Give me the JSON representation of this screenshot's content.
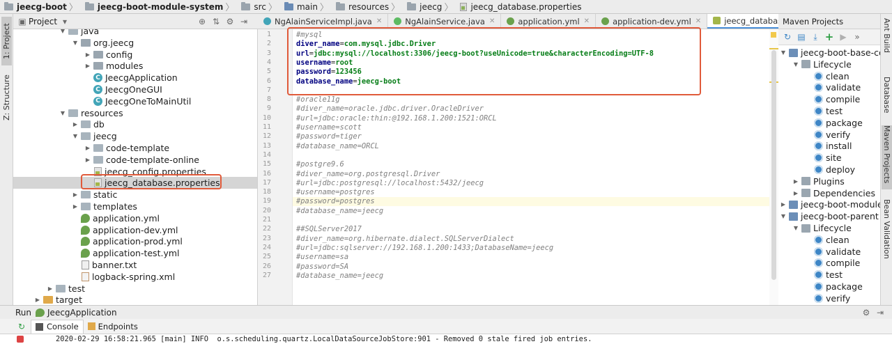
{
  "breadcrumbs": [
    "jeecg-boot",
    "jeecg-boot-module-system",
    "src",
    "main",
    "resources",
    "jeecg",
    "jeecg_database.properties"
  ],
  "left_strip": {
    "project": "1: Project",
    "structure": "Z: Structure"
  },
  "project_panel": {
    "title": "Project"
  },
  "tree": [
    {
      "label": "java",
      "depth": 4,
      "arrow": "open",
      "icon": "folder-blue"
    },
    {
      "label": "org.jeecg",
      "depth": 5,
      "arrow": "open",
      "icon": "package"
    },
    {
      "label": "config",
      "depth": 6,
      "arrow": "closed",
      "icon": "package"
    },
    {
      "label": "modules",
      "depth": 6,
      "arrow": "closed",
      "icon": "package"
    },
    {
      "label": "JeecgApplication",
      "depth": 6,
      "arrow": "none",
      "icon": "class"
    },
    {
      "label": "JeecgOneGUI",
      "depth": 6,
      "arrow": "none",
      "icon": "class"
    },
    {
      "label": "JeecgOneToMainUtil",
      "depth": 6,
      "arrow": "none",
      "icon": "class"
    },
    {
      "label": "resources",
      "depth": 4,
      "arrow": "open",
      "icon": "folder-res"
    },
    {
      "label": "db",
      "depth": 5,
      "arrow": "closed",
      "icon": "folder"
    },
    {
      "label": "jeecg",
      "depth": 5,
      "arrow": "open",
      "icon": "folder"
    },
    {
      "label": "code-template",
      "depth": 6,
      "arrow": "closed",
      "icon": "folder"
    },
    {
      "label": "code-template-online",
      "depth": 6,
      "arrow": "closed",
      "icon": "folder"
    },
    {
      "label": "jeecg_config.properties",
      "depth": 6,
      "arrow": "none",
      "icon": "properties"
    },
    {
      "label": "jeecg_database.properties",
      "depth": 6,
      "arrow": "none",
      "icon": "properties",
      "selected": true
    },
    {
      "label": "static",
      "depth": 5,
      "arrow": "closed",
      "icon": "folder"
    },
    {
      "label": "templates",
      "depth": 5,
      "arrow": "closed",
      "icon": "folder"
    },
    {
      "label": "application.yml",
      "depth": 5,
      "arrow": "none",
      "icon": "yml"
    },
    {
      "label": "application-dev.yml",
      "depth": 5,
      "arrow": "none",
      "icon": "yml"
    },
    {
      "label": "application-prod.yml",
      "depth": 5,
      "arrow": "none",
      "icon": "yml"
    },
    {
      "label": "application-test.yml",
      "depth": 5,
      "arrow": "none",
      "icon": "yml"
    },
    {
      "label": "banner.txt",
      "depth": 5,
      "arrow": "none",
      "icon": "txt"
    },
    {
      "label": "logback-spring.xml",
      "depth": 5,
      "arrow": "none",
      "icon": "xml"
    },
    {
      "label": "test",
      "depth": 3,
      "arrow": "closed",
      "icon": "folder"
    },
    {
      "label": "target",
      "depth": 2,
      "arrow": "closed",
      "icon": "folder-orange"
    }
  ],
  "editor_tabs": [
    {
      "label": "NgAlainServiceImpl.java",
      "icon": "class"
    },
    {
      "label": "NgAlainService.java",
      "icon": "interface"
    },
    {
      "label": "application.yml",
      "icon": "yml"
    },
    {
      "label": "application-dev.yml",
      "icon": "yml"
    },
    {
      "label": "jeecg_database.properties",
      "icon": "properties",
      "active": true
    }
  ],
  "tab_overflow": "≡5",
  "code_lines": [
    {
      "n": "1",
      "parts": [
        [
          "cmt",
          "#mysql"
        ]
      ]
    },
    {
      "n": "2",
      "parts": [
        [
          "key",
          "diver_name"
        ],
        [
          "eq",
          "="
        ],
        [
          "val",
          "com.mysql.jdbc.Driver"
        ]
      ]
    },
    {
      "n": "3",
      "parts": [
        [
          "key",
          "url"
        ],
        [
          "eq",
          "="
        ],
        [
          "val",
          "jdbc:mysql://localhost:3306/jeecg-boot?useUnicode=true&characterEncoding=UTF-8"
        ]
      ]
    },
    {
      "n": "4",
      "parts": [
        [
          "key",
          "username"
        ],
        [
          "eq",
          "="
        ],
        [
          "val",
          "root"
        ]
      ]
    },
    {
      "n": "5",
      "parts": [
        [
          "key",
          "password"
        ],
        [
          "eq",
          "="
        ],
        [
          "val",
          "123456"
        ]
      ]
    },
    {
      "n": "6",
      "parts": [
        [
          "key",
          "database_name"
        ],
        [
          "eq",
          "="
        ],
        [
          "val",
          "jeecg-boot"
        ]
      ]
    },
    {
      "n": "7",
      "parts": []
    },
    {
      "n": "8",
      "parts": [
        [
          "cmt",
          "#oracle11g"
        ]
      ]
    },
    {
      "n": "9",
      "parts": [
        [
          "cmt",
          "#diver_name=oracle.jdbc.driver.OracleDriver"
        ]
      ]
    },
    {
      "n": "10",
      "parts": [
        [
          "cmt",
          "#url=jdbc:oracle:thin:@192.168.1.200:1521:ORCL"
        ]
      ]
    },
    {
      "n": "11",
      "parts": [
        [
          "cmt",
          "#username=scott"
        ]
      ]
    },
    {
      "n": "12",
      "parts": [
        [
          "cmt",
          "#password=tiger"
        ]
      ]
    },
    {
      "n": "13",
      "parts": [
        [
          "cmt",
          "#database_name=ORCL"
        ]
      ]
    },
    {
      "n": "14",
      "parts": []
    },
    {
      "n": "15",
      "parts": [
        [
          "cmt",
          "#postgre9.6"
        ]
      ]
    },
    {
      "n": "16",
      "parts": [
        [
          "cmt",
          "#diver_name=org.postgresql.Driver"
        ]
      ]
    },
    {
      "n": "17",
      "parts": [
        [
          "cmt",
          "#url=jdbc:postgresql://localhost:5432/jeecg"
        ]
      ]
    },
    {
      "n": "18",
      "parts": [
        [
          "cmt",
          "#username=postgres"
        ]
      ]
    },
    {
      "n": "19",
      "parts": [
        [
          "cmt",
          "#password=postgres"
        ]
      ],
      "highlight": true
    },
    {
      "n": "20",
      "parts": [
        [
          "cmt",
          "#database_name=jeecg"
        ]
      ]
    },
    {
      "n": "21",
      "parts": []
    },
    {
      "n": "22",
      "parts": [
        [
          "cmt",
          "##SQLServer2017"
        ]
      ]
    },
    {
      "n": "23",
      "parts": [
        [
          "cmt",
          "#diver_name=org.hibernate.dialect.SQLServerDialect"
        ]
      ]
    },
    {
      "n": "24",
      "parts": [
        [
          "cmt",
          "#url=jdbc:sqlserver://192.168.1.200:1433;DatabaseName=jeecg"
        ]
      ]
    },
    {
      "n": "25",
      "parts": [
        [
          "cmt",
          "#username=sa"
        ]
      ]
    },
    {
      "n": "26",
      "parts": [
        [
          "cmt",
          "#password=SA"
        ]
      ]
    },
    {
      "n": "27",
      "parts": [
        [
          "cmt",
          "#database_name=jeecg"
        ]
      ]
    }
  ],
  "maven": {
    "title": "Maven Projects",
    "tree": [
      {
        "label": "jeecg-boot-base-co",
        "depth": 0,
        "arrow": "open",
        "icon": "maven"
      },
      {
        "label": "Lifecycle",
        "depth": 1,
        "arrow": "open",
        "icon": "folder"
      },
      {
        "label": "clean",
        "depth": 2,
        "arrow": "none",
        "icon": "gear"
      },
      {
        "label": "validate",
        "depth": 2,
        "arrow": "none",
        "icon": "gear"
      },
      {
        "label": "compile",
        "depth": 2,
        "arrow": "none",
        "icon": "gear"
      },
      {
        "label": "test",
        "depth": 2,
        "arrow": "none",
        "icon": "gear"
      },
      {
        "label": "package",
        "depth": 2,
        "arrow": "none",
        "icon": "gear"
      },
      {
        "label": "verify",
        "depth": 2,
        "arrow": "none",
        "icon": "gear"
      },
      {
        "label": "install",
        "depth": 2,
        "arrow": "none",
        "icon": "gear"
      },
      {
        "label": "site",
        "depth": 2,
        "arrow": "none",
        "icon": "gear"
      },
      {
        "label": "deploy",
        "depth": 2,
        "arrow": "none",
        "icon": "gear"
      },
      {
        "label": "Plugins",
        "depth": 1,
        "arrow": "closed",
        "icon": "folder"
      },
      {
        "label": "Dependencies",
        "depth": 1,
        "arrow": "closed",
        "icon": "folder"
      },
      {
        "label": "jeecg-boot-module-",
        "depth": 0,
        "arrow": "closed",
        "icon": "maven"
      },
      {
        "label": "jeecg-boot-parent (",
        "depth": 0,
        "arrow": "open",
        "icon": "maven"
      },
      {
        "label": "Lifecycle",
        "depth": 1,
        "arrow": "open",
        "icon": "folder"
      },
      {
        "label": "clean",
        "depth": 2,
        "arrow": "none",
        "icon": "gear"
      },
      {
        "label": "validate",
        "depth": 2,
        "arrow": "none",
        "icon": "gear"
      },
      {
        "label": "compile",
        "depth": 2,
        "arrow": "none",
        "icon": "gear"
      },
      {
        "label": "test",
        "depth": 2,
        "arrow": "none",
        "icon": "gear"
      },
      {
        "label": "package",
        "depth": 2,
        "arrow": "none",
        "icon": "gear"
      },
      {
        "label": "verify",
        "depth": 2,
        "arrow": "none",
        "icon": "gear"
      }
    ]
  },
  "right_strip": {
    "ant": "Ant Build",
    "database": "Database",
    "maven": "Maven Projects",
    "bean": "Bean Validation"
  },
  "run": {
    "label": "Run",
    "config": "JeecgApplication"
  },
  "console_tabs": {
    "console": "Console",
    "endpoints": "Endpoints"
  },
  "console_line": "2020-02-29 16:58:21.965 [main] INFO  o.s.scheduling.quartz.LocalDataSourceJobStore:901 - Removed 0 stale fired job entries.",
  "colors": {
    "accent": "#4a90d9",
    "annotation_red": "#e05a3a",
    "string_green": "#067d17",
    "key_navy": "#000080"
  }
}
